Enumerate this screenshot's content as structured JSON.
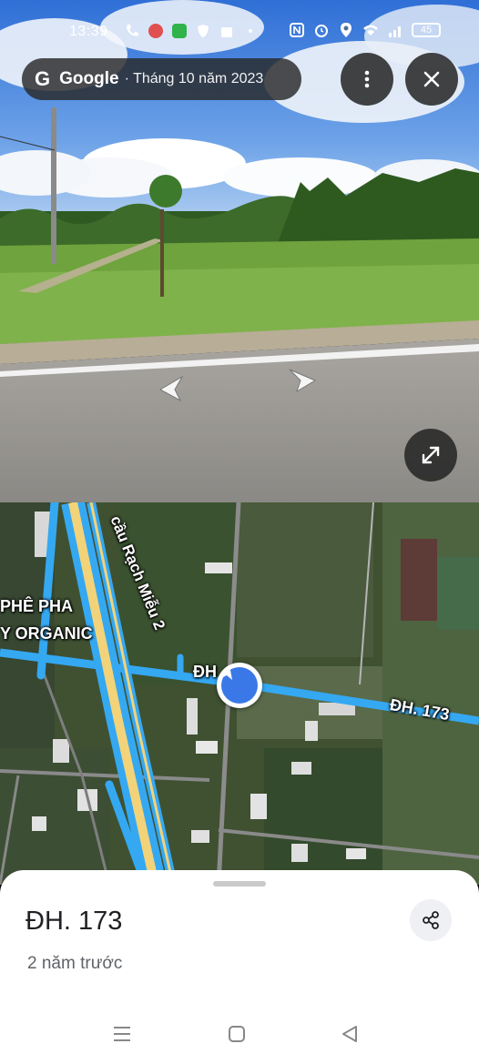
{
  "status_bar": {
    "time": "13:39",
    "battery": "45"
  },
  "streetview": {
    "brand": "Google",
    "date": "· Tháng 10 năm 2023"
  },
  "map": {
    "labels": {
      "bridge": "cầu Rạch Miễu 2",
      "road_right": "ĐH. 173",
      "road_left": "ĐH",
      "cafe_line1": "PHÊ PHA",
      "cafe_line2": "Y ORGANIC"
    }
  },
  "sheet": {
    "title": "ĐH. 173",
    "subtitle": "2 năm trước"
  },
  "icons": {
    "more": "more-vert-icon",
    "close": "close-icon",
    "expand": "expand-icon",
    "share": "share-icon"
  },
  "colors": {
    "road_blue": "#35a8f2",
    "road_yellow": "#f2d37a",
    "pin_blue": "#3b78e7"
  }
}
